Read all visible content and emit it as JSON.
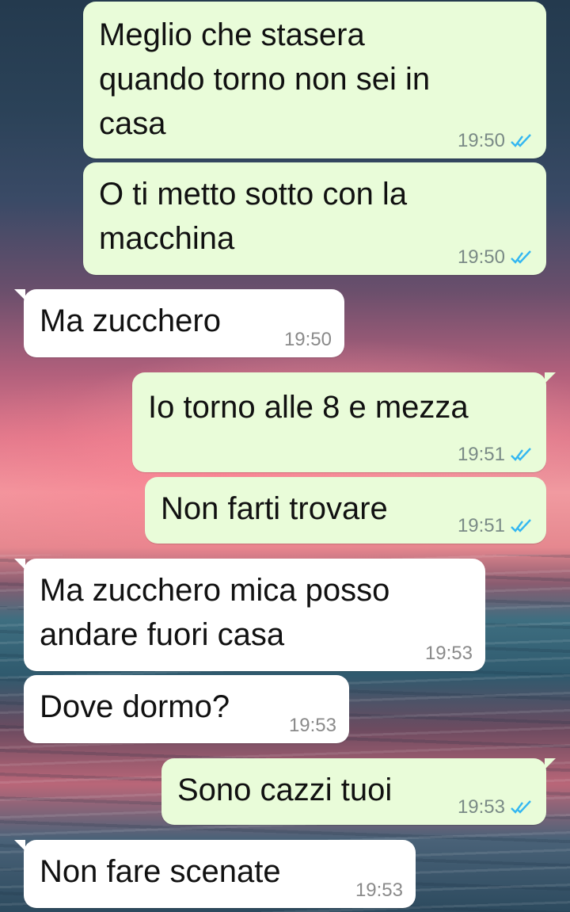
{
  "messages": [
    {
      "direction": "out",
      "text": "Meglio che stasera\nquando torno non sei in\ncasa",
      "time": "19:50",
      "status": "read"
    },
    {
      "direction": "out",
      "text": "O ti metto sotto con la\nmacchina",
      "time": "19:50",
      "status": "read"
    },
    {
      "direction": "in",
      "text": "Ma zucchero",
      "time": "19:50"
    },
    {
      "direction": "out",
      "text": "Io torno alle 8 e mezza",
      "time": "19:51",
      "status": "read"
    },
    {
      "direction": "out",
      "text": "Non farti trovare",
      "time": "19:51",
      "status": "read"
    },
    {
      "direction": "in",
      "text": "Ma zucchero mica posso\nandare fuori casa",
      "time": "19:53"
    },
    {
      "direction": "in",
      "text": "Dove dormo?",
      "time": "19:53"
    },
    {
      "direction": "out",
      "text": "Sono cazzi tuoi",
      "time": "19:53",
      "status": "read"
    },
    {
      "direction": "in",
      "text": "Non fare scenate",
      "time": "19:53"
    }
  ],
  "colors": {
    "outgoing_bubble": "#e9fcd9",
    "incoming_bubble": "#ffffff",
    "read_ticks": "#34b7f1"
  },
  "icons": {
    "read_status": "double-check-icon"
  }
}
